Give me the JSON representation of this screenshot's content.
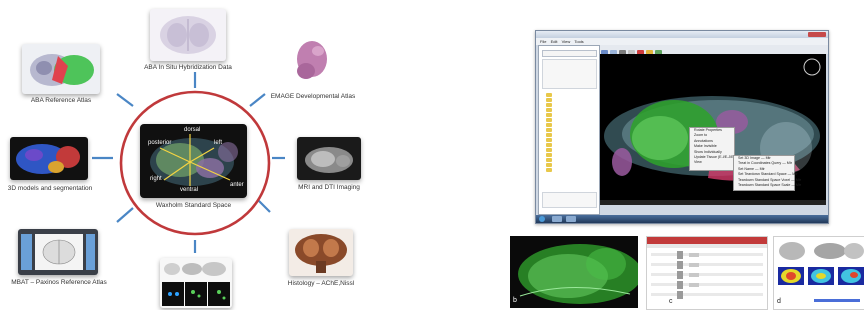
{
  "diagram": {
    "center": {
      "label": "Waxholm Standard Space",
      "axes": [
        "dorsal",
        "left",
        "posterior",
        "right",
        "ventral",
        "anter"
      ]
    },
    "nodes": [
      {
        "id": "aba-ish",
        "label": "ABA In Situ Hybridization Data"
      },
      {
        "id": "emage",
        "label": "EMAGE Developmental Atlas"
      },
      {
        "id": "mri",
        "label": "MRI and DTI Imaging"
      },
      {
        "id": "histology",
        "label": "Histology – AChE,Nissl"
      },
      {
        "id": "aba-ref",
        "label": "ABA Reference Atlas"
      },
      {
        "id": "models3d",
        "label": "3D models and segmentation"
      },
      {
        "id": "mbat",
        "label": "MBAT – Paxinos Reference Atlas"
      }
    ],
    "colors": {
      "ring": "#c0393b",
      "connector": "#4a86c5"
    }
  },
  "app": {
    "menus": [
      "File",
      "Edit",
      "View",
      "Tools"
    ],
    "context_menu": [
      "Rotate Properties",
      "Zoom to",
      "Annotations",
      "Make Invisible",
      "Show Individually",
      "Update Tissue (E-I/E-J/E-D)",
      "View"
    ],
    "submenu": [
      "Set 3D Image — Mtr",
      "Treat in Coordinates Query — Mtr",
      "Set Name — Mtr",
      "Set Teardown Standard Space — Mtr",
      "Teardown Standard Space Voxel — Mtr",
      "Teardown Standard Space Scale — Mtr"
    ],
    "panel_labels": [
      "b",
      "c",
      "d"
    ]
  }
}
